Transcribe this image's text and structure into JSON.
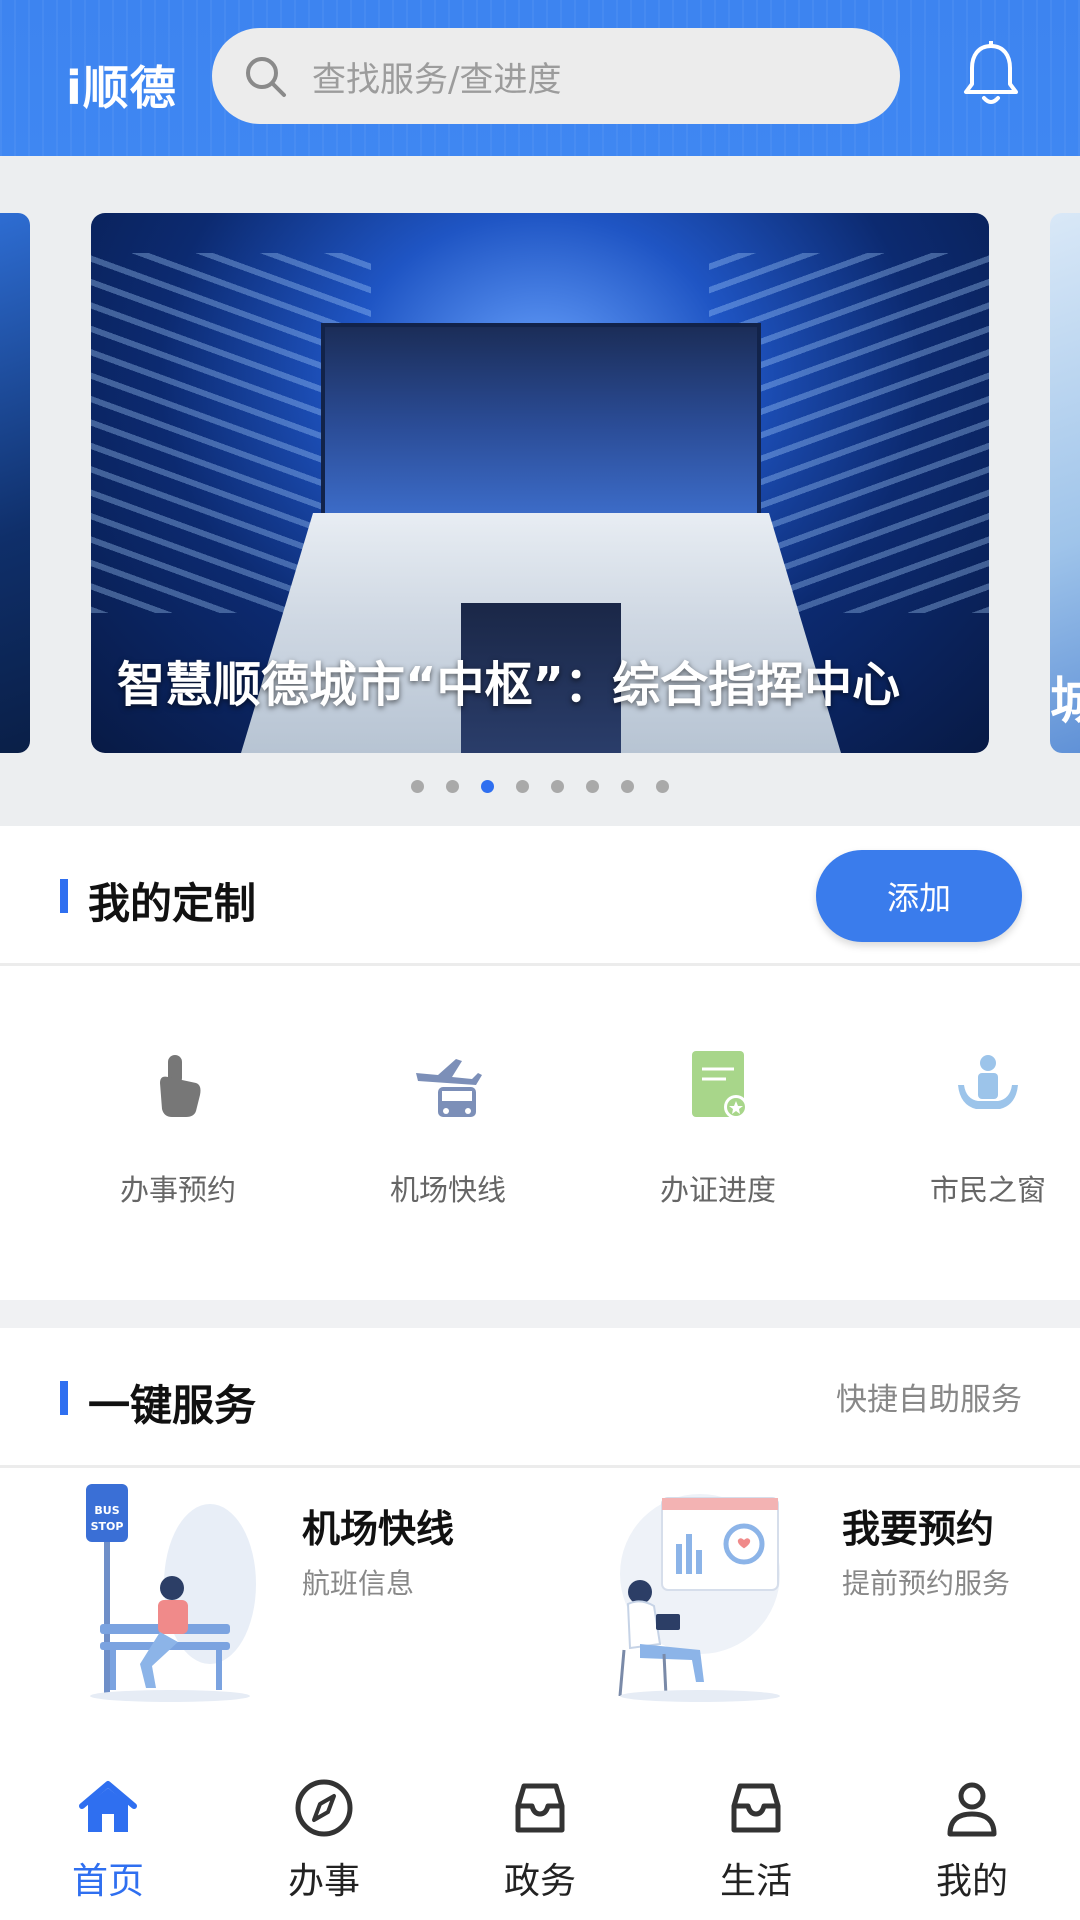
{
  "header": {
    "logo": "i顺德",
    "search_placeholder": "查找服务/查进度"
  },
  "banner": {
    "caption": "智慧顺德城市“中枢”：综合指挥中心",
    "next_caption_fragment": "城",
    "dot_count": 8,
    "active_dot_index": 2
  },
  "custom": {
    "title": "我的定制",
    "add_label": "添加",
    "items": [
      {
        "label": "办事预约",
        "icon": "hand-tap-icon",
        "color": "#777777"
      },
      {
        "label": "机场快线",
        "icon": "plane-bus-icon",
        "color": "#7c8fb8"
      },
      {
        "label": "办证进度",
        "icon": "document-star-icon",
        "color": "#a8d68a"
      },
      {
        "label": "市民之窗",
        "icon": "citizen-window-icon",
        "color": "#9cc4ea"
      }
    ]
  },
  "service": {
    "title": "一键服务",
    "subtitle": "快捷自助服务",
    "cards": [
      {
        "title": "机场快线",
        "subtitle": "航班信息",
        "illustration": "bus-stop-illustration",
        "sign": [
          "BUS",
          "STOP"
        ]
      },
      {
        "title": "我要预约",
        "subtitle": "提前预约服务",
        "illustration": "appointment-illustration"
      }
    ]
  },
  "tabs": [
    {
      "label": "首页",
      "icon": "home-icon",
      "active": true
    },
    {
      "label": "办事",
      "icon": "compass-icon",
      "active": false
    },
    {
      "label": "政务",
      "icon": "inbox-icon",
      "active": false
    },
    {
      "label": "生活",
      "icon": "inbox-icon",
      "active": false
    },
    {
      "label": "我的",
      "icon": "user-icon",
      "active": false
    }
  ],
  "colors": {
    "brand": "#3d84f0",
    "accent": "#2f6ff0"
  }
}
